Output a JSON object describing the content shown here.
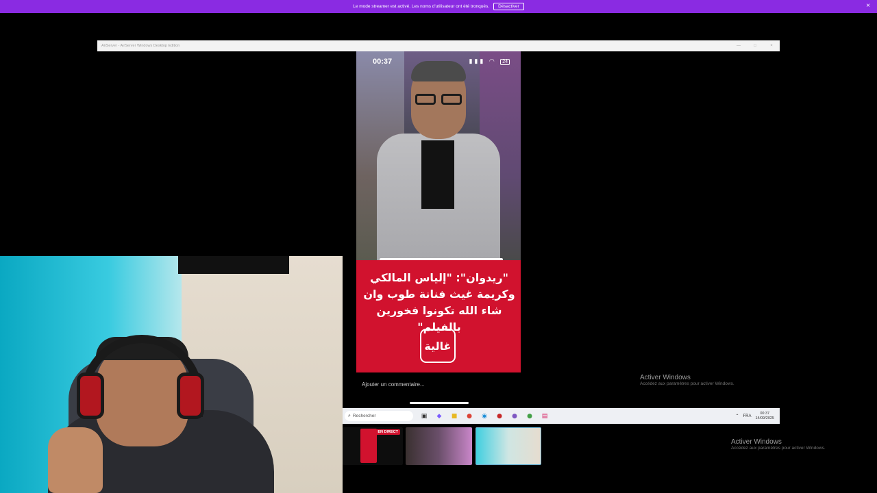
{
  "banner": {
    "message": "Le mode streamer est activé. Les noms d'utilisateur ont été tronqués.",
    "button": "Désactiver",
    "close": "×"
  },
  "window": {
    "title": "AirServer - AirServer Windows Desktop Edition",
    "min": "—",
    "max": "□",
    "close": "×"
  },
  "phone": {
    "time": "00:37",
    "signal": "▮▮▮",
    "wifi": "◠",
    "battery": "24",
    "headline": "\"ريدوان\": \"إلياس المالكي وكريمة غيث فنانة طوب وان شاء الله تكونوا فخورين بالفيلم\"",
    "logo": "غالية",
    "comment_placeholder": "Ajouter un commentaire..."
  },
  "watermark": {
    "title": "Activer Windows",
    "subtitle": "Accédez aux paramètres pour activer Windows."
  },
  "taskbar": {
    "search_icon": "⌕",
    "search_placeholder": "Rechercher",
    "icons": [
      {
        "name": "task-view-icon",
        "glyph": "▣",
        "color": "#333333"
      },
      {
        "name": "copilot-icon",
        "glyph": "◆",
        "color": "#7b5cff"
      },
      {
        "name": "file-explorer-icon",
        "glyph": "■",
        "color": "#e8b923"
      },
      {
        "name": "chrome-icon",
        "glyph": "●",
        "color": "#db4437"
      },
      {
        "name": "edge-icon",
        "glyph": "◉",
        "color": "#1e8fd8"
      },
      {
        "name": "chrome-profile-icon",
        "glyph": "●",
        "color": "#c62828"
      },
      {
        "name": "app-purple-icon",
        "glyph": "●",
        "color": "#7e57c2"
      },
      {
        "name": "chrome-alt-icon",
        "glyph": "●",
        "color": "#43a047"
      },
      {
        "name": "app-red-icon",
        "glyph": "▤",
        "color": "#d81b60"
      }
    ],
    "tray": {
      "chevron": "⌃",
      "language": "FRA",
      "time": "00:37",
      "date": "14/09/2025"
    }
  },
  "thumbnails": {
    "live_label": "EN DIRECT"
  }
}
